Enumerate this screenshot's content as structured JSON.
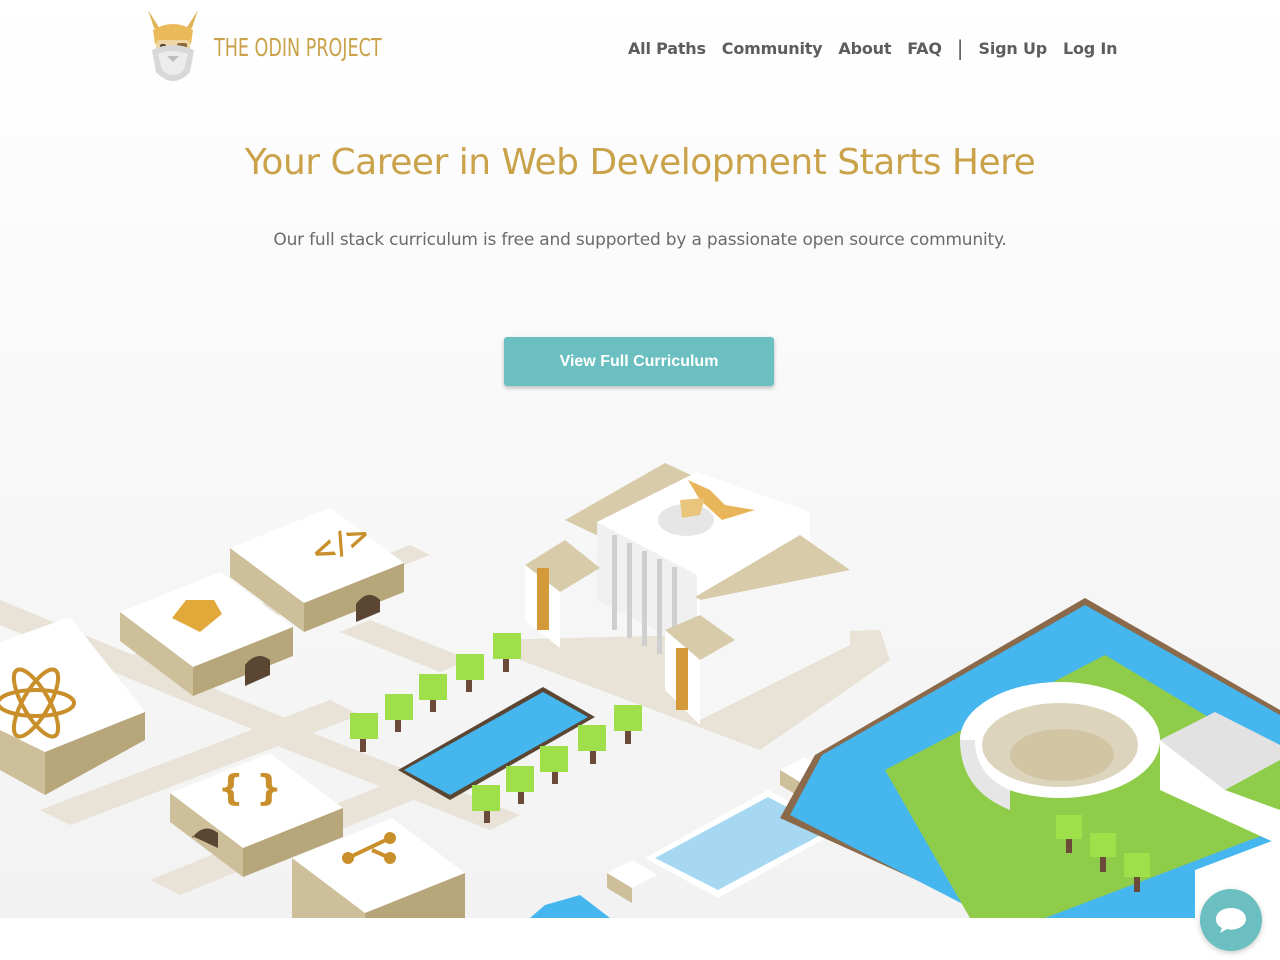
{
  "header": {
    "logo_text": "THE ODIN PROJECT",
    "nav": [
      {
        "label": "All Paths"
      },
      {
        "label": "Community"
      },
      {
        "label": "About"
      },
      {
        "label": "FAQ"
      },
      {
        "label": "Sign Up"
      },
      {
        "label": "Log In"
      }
    ],
    "separator": "|"
  },
  "hero": {
    "headline": "Your Career in Web Development Starts Here",
    "subline": "Our full stack curriculum is free and supported by a passionate open source community.",
    "cta_label": "View Full Curriculum"
  },
  "scene": {
    "building_icons": [
      "html-tags",
      "ruby-gem",
      "react-atom",
      "curly-braces",
      "git-branch"
    ],
    "html_icon_text": "</>"
  },
  "colors": {
    "brand_gold": "#c9a24a",
    "accent_teal": "#6cbfc1",
    "water_blue": "#45b6ee",
    "grass_green": "#8fcc4a",
    "nav_text": "#5d5d5d"
  },
  "chat": {
    "icon": "chat-bubble-icon"
  }
}
